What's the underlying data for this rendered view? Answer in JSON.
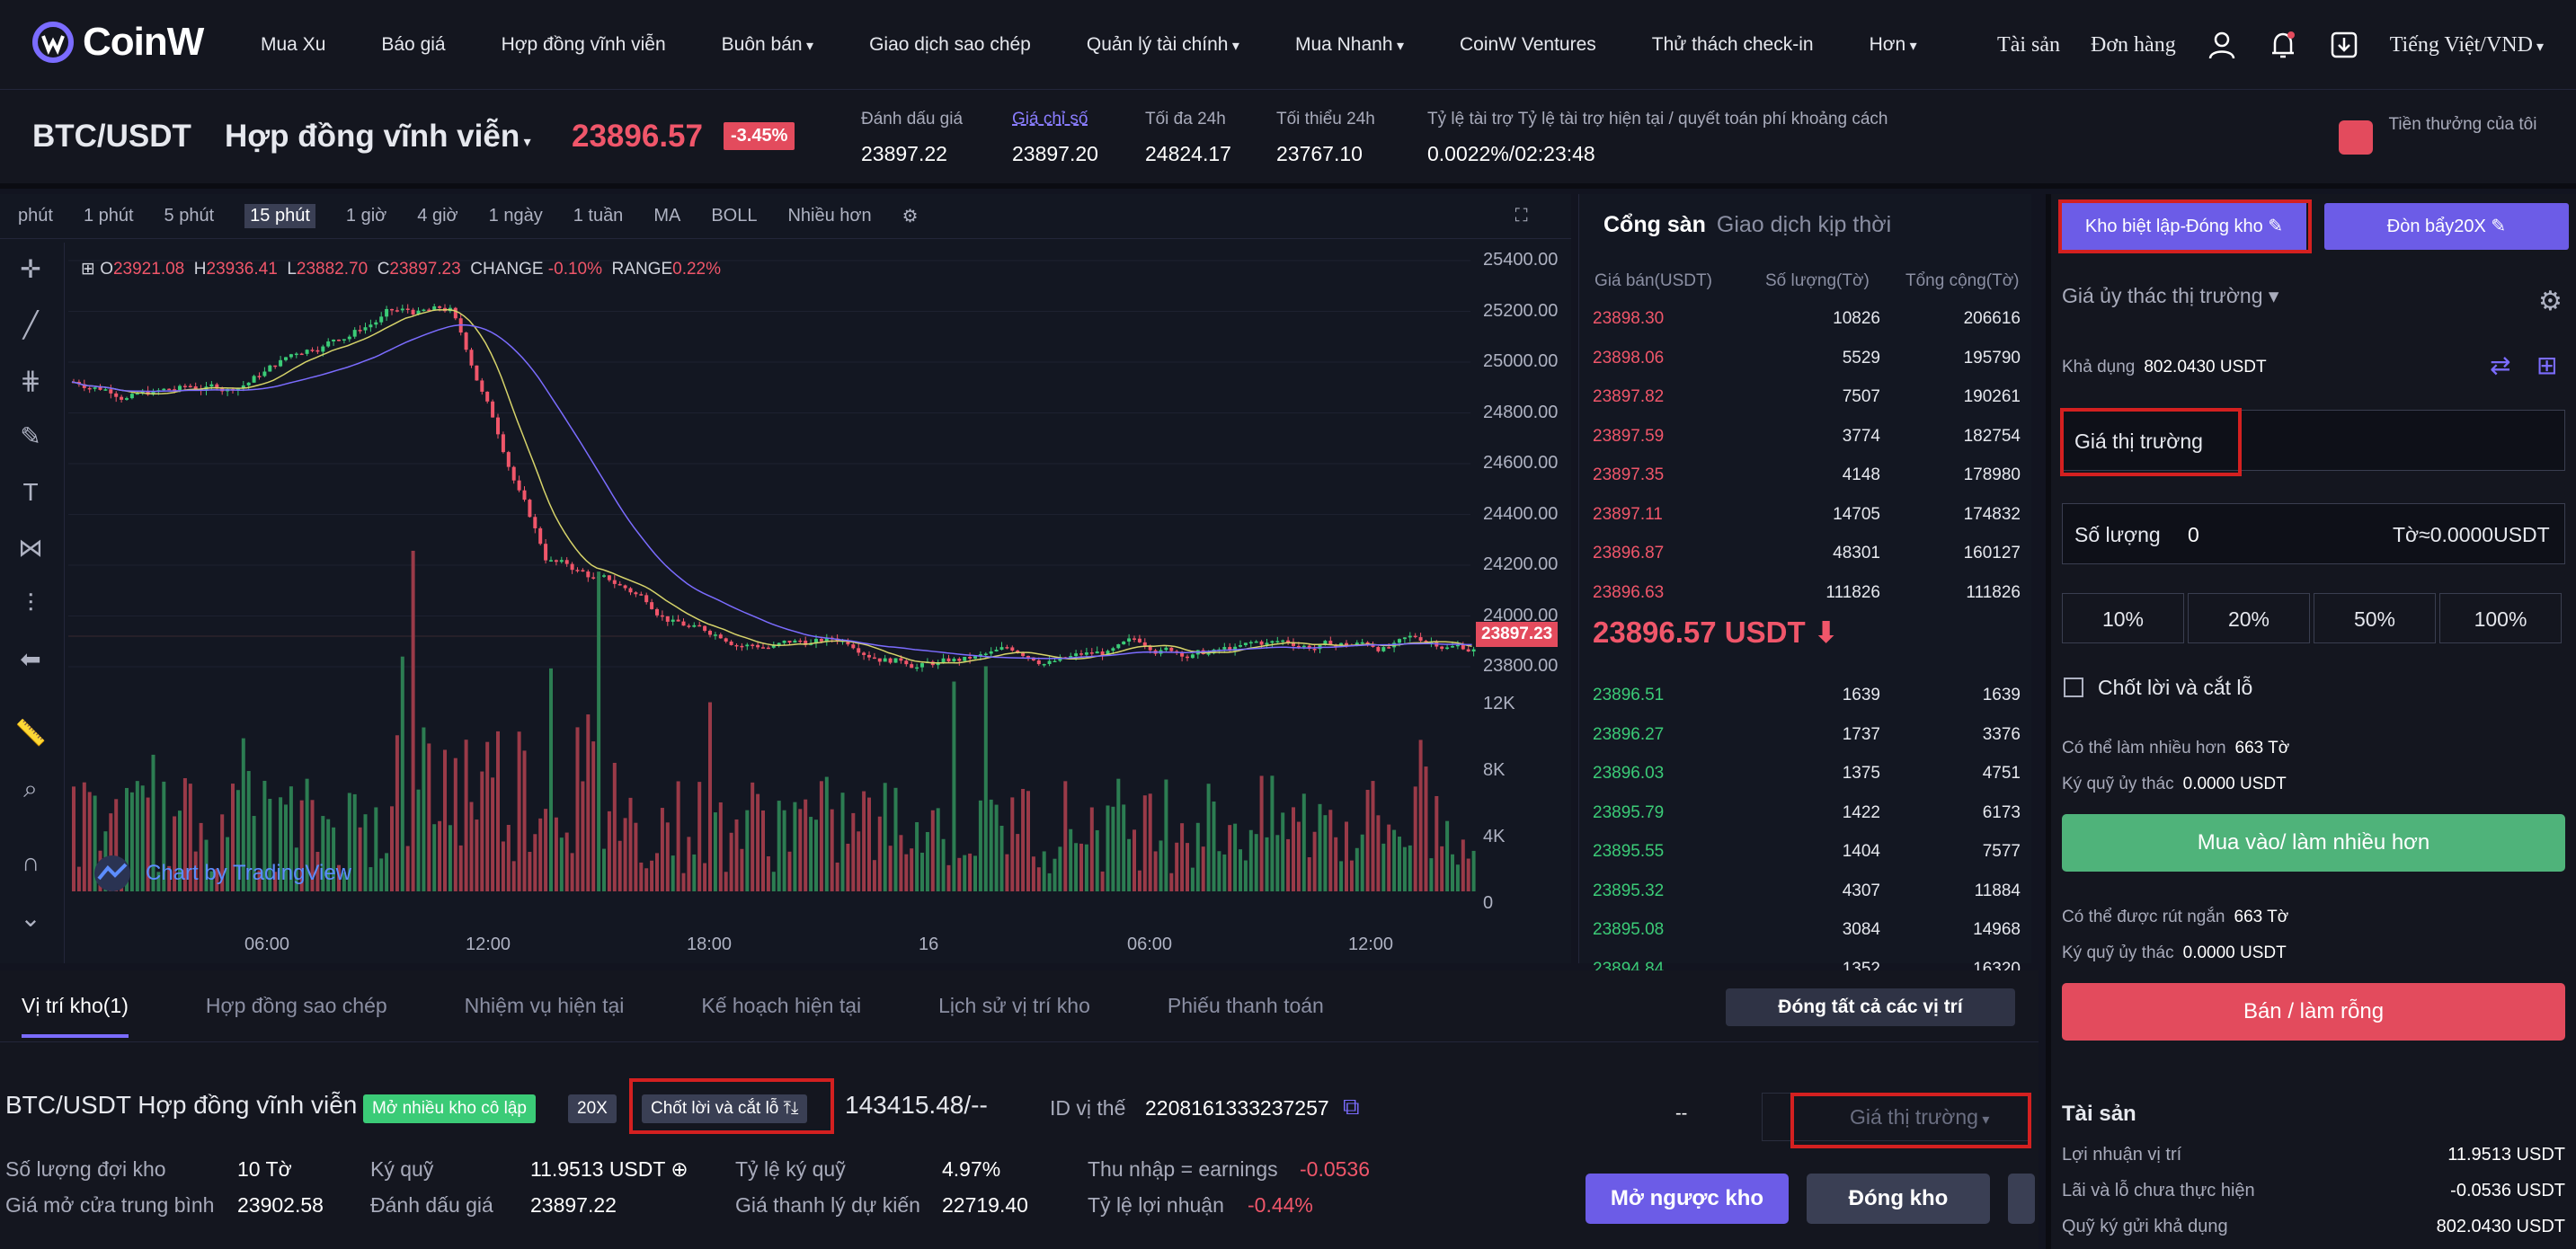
{
  "nav": {
    "logo": "CoinW",
    "items": [
      "Mua Xu",
      "Báo giá",
      "Hợp đồng vĩnh viễn",
      "Buôn bán",
      "Giao dịch sao chép",
      "Quản lý tài chính",
      "Mua Nhanh",
      "CoinW Ventures",
      "Thử thách check-in",
      "Hơn"
    ],
    "assets": "Tài sản",
    "orders": "Đơn hàng",
    "language": "Tiếng Việt/VND"
  },
  "ticker": {
    "pair": "BTC/USDT",
    "contract_type": "Hợp đồng vĩnh viễn",
    "last_price": "23896.57",
    "change": "-3.45%",
    "stats": [
      {
        "label": "Đánh dấu giá",
        "value": "23897.22"
      },
      {
        "label": "Giá chỉ số",
        "value": "23897.20"
      },
      {
        "label": "Tối đa 24h",
        "value": "24824.17"
      },
      {
        "label": "Tối thiểu 24h",
        "value": "23767.10"
      },
      {
        "label": "Tỷ lệ tài trợ Tỷ lệ tài trợ hiện tại / quyết toán phí khoảng cách",
        "value": "0.0022%/02:23:48"
      }
    ],
    "bonus": "Tiền thưởng của tôi"
  },
  "chart": {
    "timeframes": [
      "phút",
      "1 phút",
      "5 phút",
      "15 phút",
      "1 giờ",
      "4 giờ",
      "1 ngày",
      "1 tuần",
      "MA",
      "BOLL",
      "Nhiều hơn"
    ],
    "active_tf": "15 phút",
    "ohlc": {
      "o": "23921.08",
      "h": "23936.41",
      "l": "23882.70",
      "c": "23897.23",
      "change": "-0.10%",
      "range": "0.22%"
    },
    "y_ticks": [
      "25400.00",
      "25200.00",
      "25000.00",
      "24800.00",
      "24600.00",
      "24400.00",
      "24200.00",
      "24000.00",
      "23800.00"
    ],
    "vol_ticks": [
      "12K",
      "8K",
      "4K",
      "0"
    ],
    "x_ticks": [
      "06:00",
      "12:00",
      "18:00",
      "16",
      "06:00",
      "12:00"
    ],
    "current_tag": "23897.23",
    "watermark": "Chart by TradingView"
  },
  "book": {
    "tab_active": "Cổng sàn",
    "tab_other": "Giao dịch kịp thời",
    "headers": [
      "Giá bán(USDT)",
      "Số lượng(Tờ)",
      "Tổng cộng(Tờ)"
    ],
    "asks": [
      [
        "23898.30",
        "10826",
        "206616"
      ],
      [
        "23898.06",
        "5529",
        "195790"
      ],
      [
        "23897.82",
        "7507",
        "190261"
      ],
      [
        "23897.59",
        "3774",
        "182754"
      ],
      [
        "23897.35",
        "4148",
        "178980"
      ],
      [
        "23897.11",
        "14705",
        "174832"
      ],
      [
        "23896.87",
        "48301",
        "160127"
      ],
      [
        "23896.63",
        "111826",
        "111826"
      ]
    ],
    "mid": "23896.57 USDT ⬇",
    "bids": [
      [
        "23896.51",
        "1639",
        "1639"
      ],
      [
        "23896.27",
        "1737",
        "3376"
      ],
      [
        "23896.03",
        "1375",
        "4751"
      ],
      [
        "23895.79",
        "1422",
        "6173"
      ],
      [
        "23895.55",
        "1404",
        "7577"
      ],
      [
        "23895.32",
        "4307",
        "11884"
      ],
      [
        "23895.08",
        "3084",
        "14968"
      ],
      [
        "23894.84",
        "1352",
        "16320"
      ]
    ]
  },
  "positions": {
    "tabs": [
      "Vị trí kho(1)",
      "Hợp đồng sao chép",
      "Nhiệm vụ hiện tại",
      "Kế hoạch hiện tại",
      "Lịch sử vị trí kho",
      "Phiếu thanh toán"
    ],
    "close_all": "Đóng tất cả các vị trí",
    "pair": "BTC/USDT Hợp đồng vĩnh viễn",
    "mode": "Mở nhiều kho cô lập",
    "leverage": "20X",
    "tpsl": "Chốt lời và cắt lỗ ⤒⤓",
    "amount": "143415.48/--",
    "id_label": "ID vị thế",
    "id": "2208161333237257",
    "dash": "--",
    "market": "Giá thị trường",
    "qty_label": "Số lượng đợi kho",
    "qty": "10 Tờ",
    "margin_label": "Ký quỹ",
    "margin": "11.9513 USDT ⊕",
    "margin_rate_label": "Tỷ lệ ký quỹ",
    "margin_rate": "4.97%",
    "pnl_label": "Thu nhập = earnings",
    "pnl": "-0.0536",
    "avg_label": "Giá mở cửa trung bình",
    "avg": "23902.58",
    "mark_label": "Đánh dấu giá",
    "mark": "23897.22",
    "liq_label": "Giá thanh lý dự kiến",
    "liq": "22719.40",
    "roe_label": "Tỷ lệ lợi nhuận",
    "roe": "-0.44%",
    "reverse": "Mở ngược kho",
    "close": "Đóng kho"
  },
  "order": {
    "margin_mode": "Kho biệt lập-Đóng kho ✎",
    "leverage": "Đòn bẩy20X ✎",
    "order_type": "Giá ủy thác thị trường ▾",
    "available_label": "Khả dụng",
    "available": "802.0430 USDT",
    "price_placeholder": "Giá thị trường",
    "qty_label": "Số lượng",
    "qty": "0",
    "qty_unit": "Tờ≈0.0000USDT",
    "pcts": [
      "10%",
      "20%",
      "50%",
      "100%"
    ],
    "tpsl": "Chốt lời và cắt lỗ",
    "long_max_label": "Có thể làm nhiều hơn",
    "long_max": "663 Tờ",
    "long_margin_label": "Ký quỹ ủy thác",
    "long_margin": "0.0000 USDT",
    "buy": "Mua vào/ làm nhiều hơn",
    "short_max_label": "Có thể được rút ngắn",
    "short_max": "663 Tờ",
    "short_margin_label": "Ký quỹ ủy thác",
    "short_margin": "0.0000 USDT",
    "sell": "Bán / làm rỗng",
    "assets_title": "Tài sản",
    "assets": [
      [
        "Lợi nhuận vị trí",
        "11.9513 USDT"
      ],
      [
        "Lãi và lỗ chưa thực hiện",
        "-0.0536 USDT"
      ],
      [
        "Quỹ ký gửi khả dụng",
        "802.0430 USDT"
      ]
    ]
  },
  "colors": {
    "accent": "#6c5ce7",
    "up": "#3bcb77",
    "down": "#f0566a",
    "highlight": "#d42020"
  }
}
